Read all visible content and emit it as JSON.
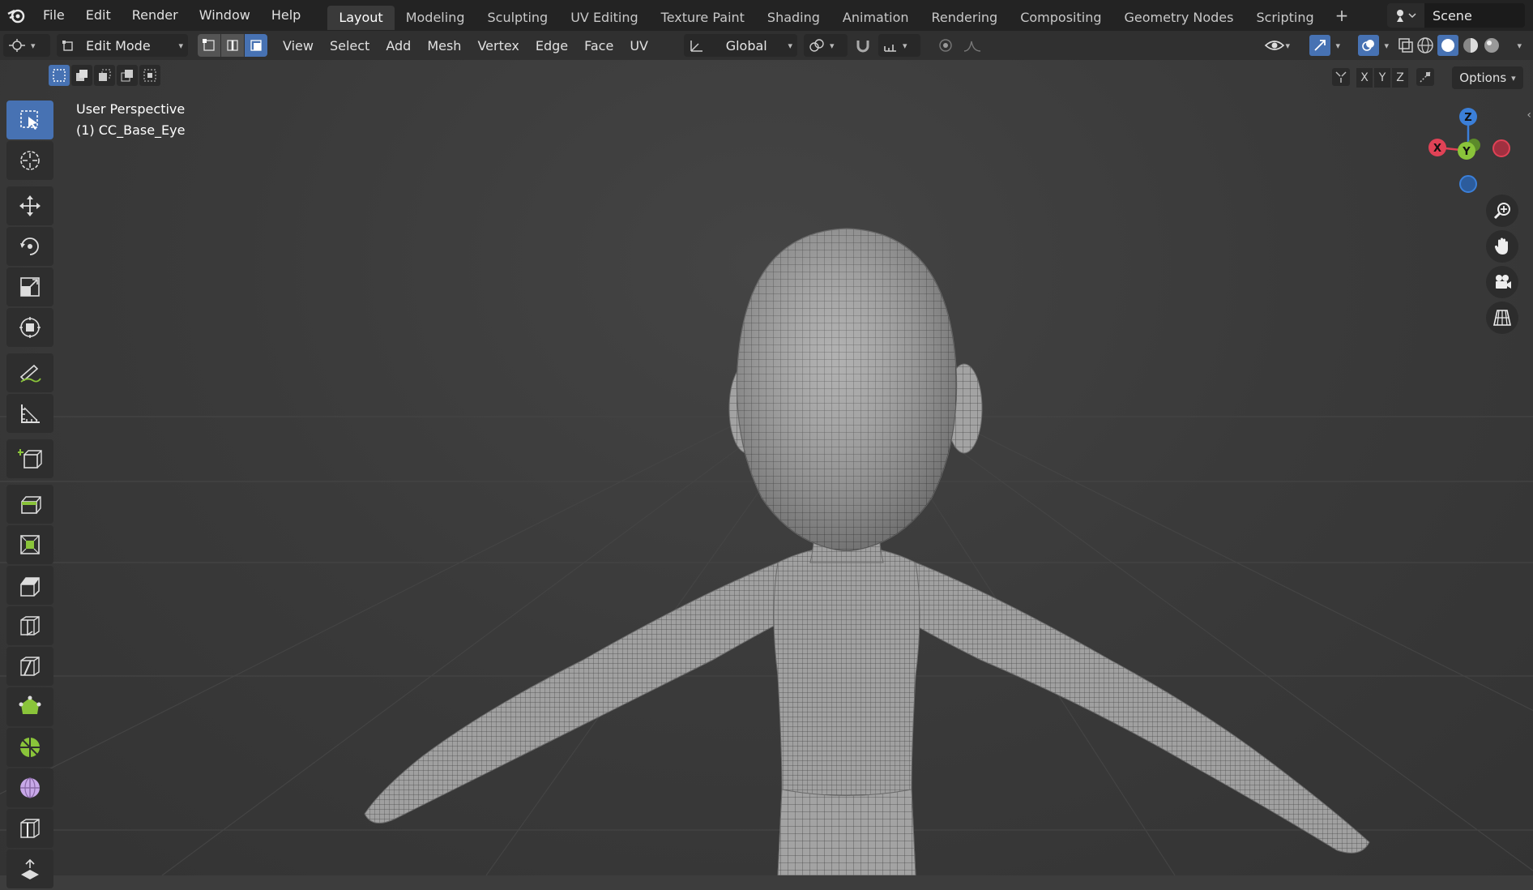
{
  "topbar": {
    "menu": [
      "File",
      "Edit",
      "Render",
      "Window",
      "Help"
    ],
    "tabs": [
      {
        "label": "Layout",
        "active": true
      },
      {
        "label": "Modeling",
        "active": false
      },
      {
        "label": "Sculpting",
        "active": false
      },
      {
        "label": "UV Editing",
        "active": false
      },
      {
        "label": "Texture Paint",
        "active": false
      },
      {
        "label": "Shading",
        "active": false
      },
      {
        "label": "Animation",
        "active": false
      },
      {
        "label": "Rendering",
        "active": false
      },
      {
        "label": "Compositing",
        "active": false
      },
      {
        "label": "Geometry Nodes",
        "active": false
      },
      {
        "label": "Scripting",
        "active": false
      }
    ],
    "add_tab": "+",
    "scene": "Scene"
  },
  "header": {
    "mode": "Edit Mode",
    "menus": [
      "View",
      "Select",
      "Add",
      "Mesh",
      "Vertex",
      "Edge",
      "Face",
      "UV"
    ],
    "orientation": "Global"
  },
  "viewport": {
    "perspective": "User Perspective",
    "object": "(1) CC_Base_Eye",
    "options_label": "Options",
    "axes": [
      "X",
      "Y",
      "Z"
    ]
  },
  "gizmo": {
    "x": "X",
    "y": "Y",
    "z": "Z"
  },
  "colors": {
    "accent": "#4772b3",
    "x_axis": "#e04256",
    "y_axis": "#8ac43a",
    "z_axis": "#3b7fd8",
    "mesh": "#9a9a9a",
    "wire": "#2b2b2b"
  }
}
